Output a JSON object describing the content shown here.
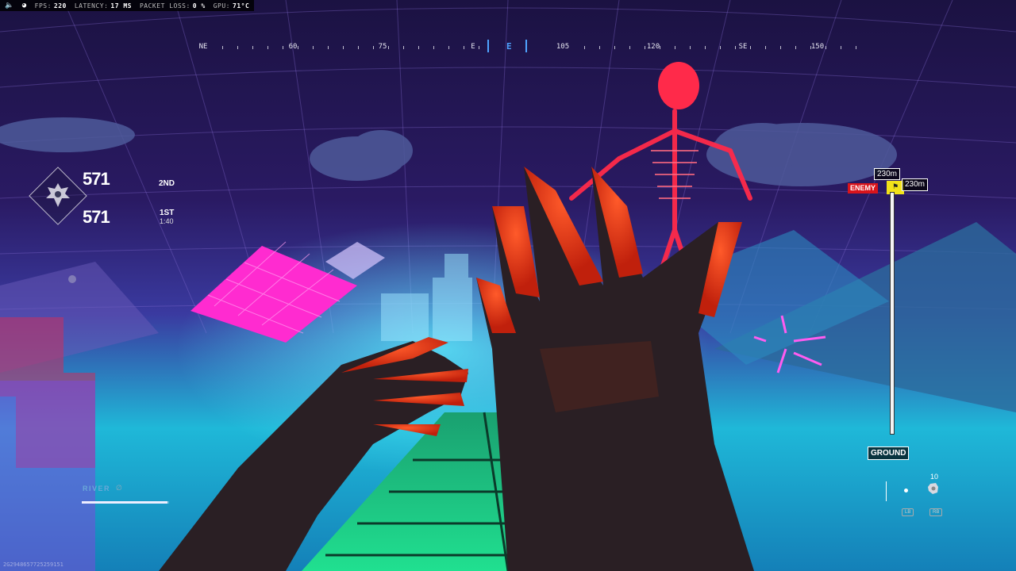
{
  "perf": {
    "fps_label": "FPS:",
    "fps": "220",
    "latency_label": "LATENCY:",
    "latency": "17 MS",
    "loss_label": "PACKET LOSS:",
    "loss": "0 %",
    "gpu_label": "GPU:",
    "gpu": "71°C"
  },
  "compass": {
    "marks": [
      "NE",
      "60",
      "75",
      "E",
      "105",
      "120",
      "SE",
      "150"
    ],
    "current": "E"
  },
  "score": {
    "team1_score": "571",
    "team1_place": "2ND",
    "team2_score": "571",
    "team2_place": "1ST",
    "time": "1:40"
  },
  "altimeter": {
    "top_distance": "230m",
    "enemy_label": "ENEMY",
    "enemy_distance": "230m",
    "ground_label": "GROUND"
  },
  "equipment": {
    "count": "10",
    "key1": "LB",
    "key2": "RB"
  },
  "player": {
    "name": "RIVER",
    "health_fraction": 0.98
  },
  "watermark": "2G2948657725259151",
  "colors": {
    "enemy": "#d8141c",
    "flag": "#f2e21a",
    "compass_current": "#4fa3ff",
    "player_name": "#6aa8d8"
  }
}
